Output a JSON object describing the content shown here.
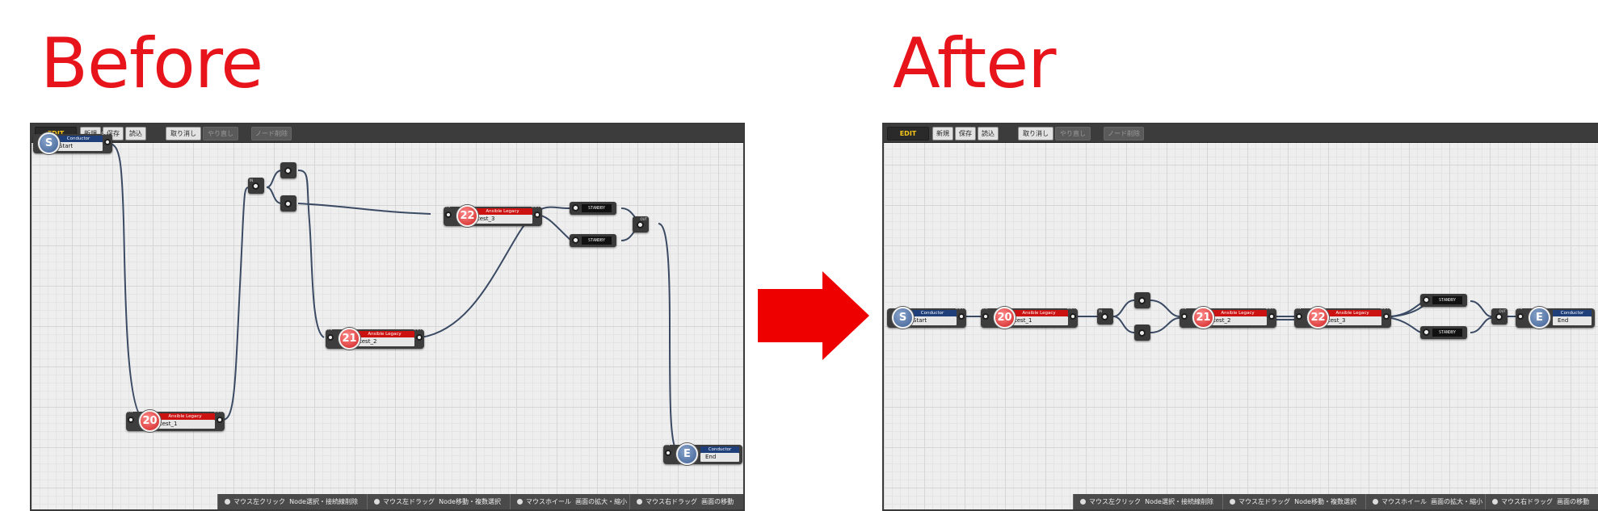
{
  "headings": {
    "before": "Before",
    "after": "After"
  },
  "toolbar": {
    "mode": "EDIT",
    "new": "新規",
    "save": "保存",
    "load": "読込",
    "undo": "取り消し",
    "redo": "やり直し",
    "delete_node": "ノード削除"
  },
  "status": {
    "left_click_label": "マウス左クリック",
    "left_click_action": "Node選択・接続線削除",
    "left_drag_label": "マウス左ドラッグ",
    "left_drag_action": "Node移動・複数選択",
    "wheel_label": "マウスホイール",
    "wheel_action": "画面の拡大・縮小",
    "right_drag_label": "マウス右ドラッグ",
    "right_drag_action": "画面の移動"
  },
  "node_text": {
    "in": "IN",
    "out": "OUT",
    "conductor": "Conductor",
    "ansible": "Ansible Legacy",
    "start": "Start",
    "end": "End",
    "s": "S",
    "e": "E",
    "n20": "20",
    "n21": "21",
    "n22": "22",
    "test1": "test_1",
    "test2": "test_2",
    "test3": "test_3",
    "standby": "STANDBY"
  },
  "colors": {
    "heading_red": "#e8141b",
    "arrow_red": "#ee0000",
    "conductor_blue": "#1e3f7a",
    "ansible_red": "#cc1111",
    "wire": "#3b4a63"
  }
}
